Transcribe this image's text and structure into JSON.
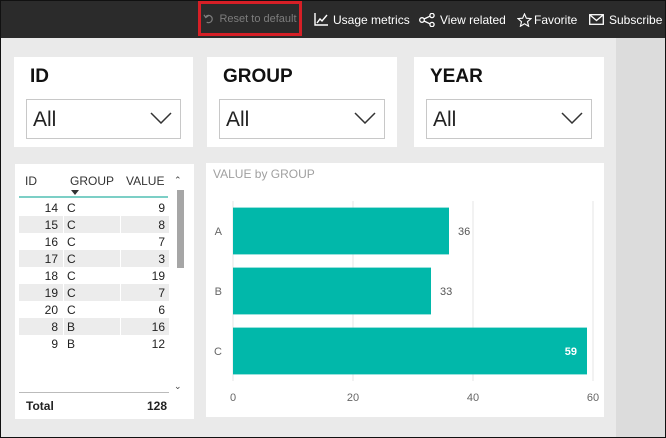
{
  "toolbar": {
    "reset": "Reset to default",
    "usage_metrics": "Usage metrics",
    "view_related": "View related",
    "favorite": "Favorite",
    "subscribe": "Subscribe"
  },
  "slicers": [
    {
      "title": "ID",
      "value": "All"
    },
    {
      "title": "GROUP",
      "value": "All"
    },
    {
      "title": "YEAR",
      "value": "All"
    }
  ],
  "table": {
    "columns": [
      "ID",
      "GROUP",
      "VALUE"
    ],
    "rows": [
      {
        "id": "14",
        "group": "C",
        "value": "9"
      },
      {
        "id": "15",
        "group": "C",
        "value": "8"
      },
      {
        "id": "16",
        "group": "C",
        "value": "7"
      },
      {
        "id": "17",
        "group": "C",
        "value": "3"
      },
      {
        "id": "18",
        "group": "C",
        "value": "19"
      },
      {
        "id": "19",
        "group": "C",
        "value": "7"
      },
      {
        "id": "20",
        "group": "C",
        "value": "6"
      },
      {
        "id": "8",
        "group": "B",
        "value": "16"
      },
      {
        "id": "9",
        "group": "B",
        "value": "12"
      }
    ],
    "total_label": "Total",
    "total_value": "128"
  },
  "chart_data": {
    "type": "bar",
    "orientation": "horizontal",
    "title": "VALUE by GROUP",
    "categories": [
      "A",
      "B",
      "C"
    ],
    "values": [
      36,
      33,
      59
    ],
    "xlim": [
      0,
      60
    ],
    "xticks": [
      0,
      20,
      40,
      60
    ],
    "bar_color": "#01b8aa",
    "grid": true
  }
}
